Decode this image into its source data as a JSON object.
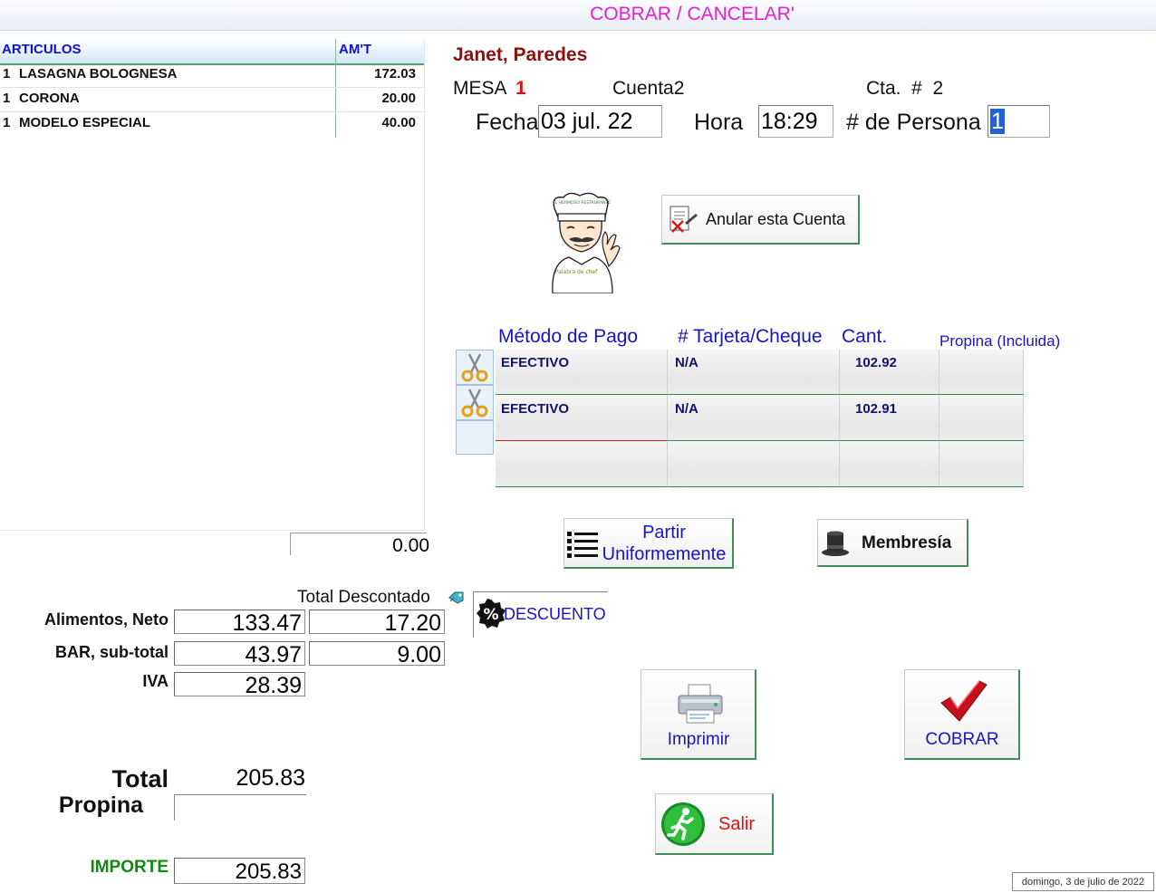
{
  "window": {
    "title": "COBRAR / CANCELAR'"
  },
  "items_table": {
    "headers": {
      "article": "ARTICULOS",
      "amount": "AM'T"
    },
    "rows": [
      {
        "qty": "1",
        "desc": "LASAGNA BOLOGNESA",
        "amt": "172.03"
      },
      {
        "qty": "1",
        "desc": "CORONA",
        "amt": "20.00"
      },
      {
        "qty": "1",
        "desc": "MODELO ESPECIAL",
        "amt": "40.00"
      }
    ],
    "subtotal": "0.00"
  },
  "header": {
    "customer": "Janet, Paredes",
    "mesa_label": "MESA",
    "mesa_number": "1",
    "cuenta": "Cuenta2",
    "cta": "Cta.  #  2",
    "fecha_label": "Fecha",
    "fecha_value": "03 jul. 22",
    "hora_label": "Hora",
    "hora_value": "18:29",
    "personas_label": "# de Persona",
    "personas_value": "1"
  },
  "chef": {
    "hat_text": "EL HERMOSO RESTAURANTE",
    "caption": "Palabra de chef"
  },
  "buttons": {
    "anular": "Anular esta Cuenta",
    "partir_1": "Partir",
    "partir_2": "Uniformemente",
    "membresia": "Membresía",
    "descuento": "DESCUENTO",
    "imprimir": "Imprimir",
    "cobrar": "COBRAR",
    "salir": "Salir"
  },
  "payments": {
    "headers": {
      "method": "Método de Pago",
      "card": "# Tarjeta/Cheque",
      "amount": "Cant.",
      "tip": "Propina (Incluida)"
    },
    "rows": [
      {
        "method": "EFECTIVO",
        "card": "N/A",
        "amount": "102.92",
        "tip": ""
      },
      {
        "method": "EFECTIVO",
        "card": "N/A",
        "amount": "102.91",
        "tip": ""
      },
      {
        "method": "",
        "card": "",
        "amount": "",
        "tip": ""
      }
    ]
  },
  "totals": {
    "descontado_label": "Total Descontado",
    "alimentos_label": "Alimentos, Neto",
    "alimentos_value": "133.47",
    "alimentos_desc": "17.20",
    "bar_label": "BAR, sub-total",
    "bar_value": "43.97",
    "bar_desc": "9.00",
    "iva_label": "IVA",
    "iva_value": "28.39",
    "total_label": "Total",
    "total_value": "205.83",
    "propina_label": "Propina",
    "propina_value": "",
    "importe_label": "IMPORTE",
    "importe_value": "205.83"
  },
  "status": {
    "date": "domingo, 3 de julio de 2022"
  },
  "colors": {
    "title": "#e61fd1",
    "customer": "#8b1010",
    "blue": "#1414c8",
    "green": "#138a13",
    "red": "#e01010"
  }
}
